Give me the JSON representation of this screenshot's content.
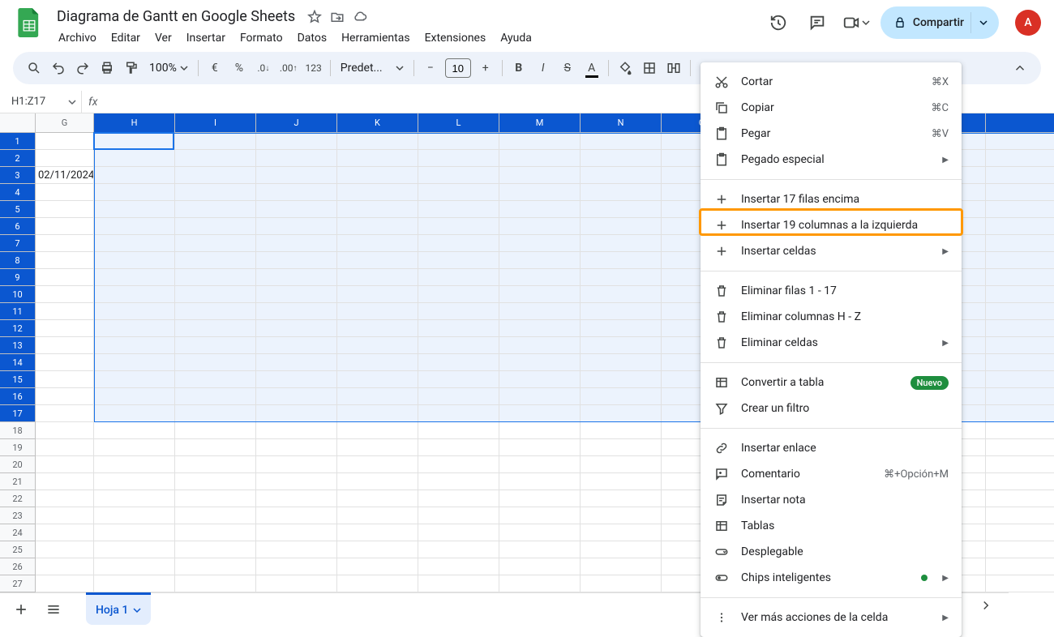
{
  "doc_title": "Diagrama de Gantt en Google Sheets",
  "menus": [
    "Archivo",
    "Editar",
    "Ver",
    "Insertar",
    "Formato",
    "Datos",
    "Herramientas",
    "Extensiones",
    "Ayuda"
  ],
  "share_label": "Compartir",
  "avatar_letter": "A",
  "toolbar": {
    "zoom": "100%",
    "font": "Predet...",
    "font_size": "10"
  },
  "name_box": "H1:Z17",
  "columns": [
    "G",
    "H",
    "I",
    "J",
    "K",
    "L",
    "M",
    "N",
    "O"
  ],
  "selected_cols_from": 1,
  "rows_count": 27,
  "selected_rows_to": 17,
  "cell_g3": "02/11/2024",
  "sheet_tab": "Hoja 1",
  "ctx": {
    "cut": "Cortar",
    "cut_k": "⌘X",
    "copy": "Copiar",
    "copy_k": "⌘C",
    "paste": "Pegar",
    "paste_k": "⌘V",
    "paste_special": "Pegado especial",
    "ins_rows": "Insertar 17 filas encima",
    "ins_cols": "Insertar 19 columnas a la izquierda",
    "ins_cells": "Insertar celdas",
    "del_rows": "Eliminar filas 1 - 17",
    "del_cols": "Eliminar columnas H - Z",
    "del_cells": "Eliminar celdas",
    "to_table": "Convertir a tabla",
    "new_badge": "Nuevo",
    "filter": "Crear un filtro",
    "link": "Insertar enlace",
    "comment": "Comentario",
    "comment_k": "⌘+Opción+M",
    "note": "Insertar nota",
    "tables": "Tablas",
    "dropdown": "Desplegable",
    "chips": "Chips inteligentes",
    "more": "Ver más acciones de la celda"
  }
}
